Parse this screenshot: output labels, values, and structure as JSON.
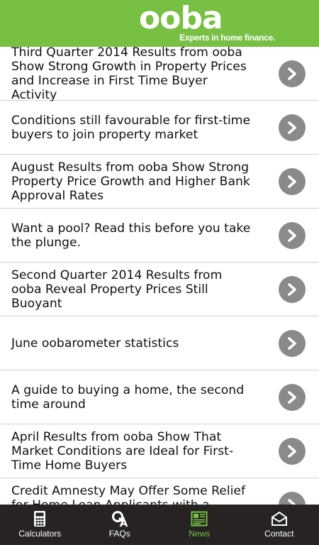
{
  "header": {
    "logo_text": "ooba",
    "tagline": "Experts in home finance."
  },
  "articles": [
    {
      "title": "Third Quarter 2014 Results from ooba Show Strong Growth in Property Prices and Increase in First Time Buyer Activity"
    },
    {
      "title": "Conditions still favourable for first-time buyers to join property market"
    },
    {
      "title": "August Results from ooba Show Strong Property Price Growth and Higher Bank Approval Rates"
    },
    {
      "title": "Want a pool? Read this before you take the plunge."
    },
    {
      "title": "Second Quarter 2014 Results from ooba Reveal Property Prices Still Buoyant"
    },
    {
      "title": "June oobarometer statistics"
    },
    {
      "title": "A guide to buying a home, the second time around"
    },
    {
      "title": "April Results from ooba Show That Market Conditions are Ideal for First-Time Home Buyers"
    },
    {
      "title": "Credit Amnesty May Offer Some Relief for Home Loan Applicants with a Flawed"
    }
  ],
  "tabs": [
    {
      "label": "Calculators",
      "icon": "calculator-icon",
      "active": false
    },
    {
      "label": "FAQs",
      "icon": "qa-icon",
      "active": false
    },
    {
      "label": "News",
      "icon": "newspaper-icon",
      "active": true
    },
    {
      "label": "Contact",
      "icon": "envelope-icon",
      "active": false
    }
  ],
  "colors": {
    "brand_green": "#77c043",
    "tabbar_bg": "#262322",
    "chevron_grey": "#8a8a8a"
  }
}
